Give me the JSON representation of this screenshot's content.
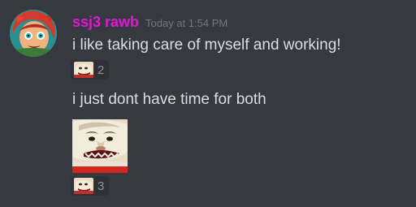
{
  "message": {
    "username": "ssj3 rawb",
    "username_color": "#e018d6",
    "timestamp": "Today at 1:54 PM",
    "lines": [
      "i like taking care of myself and working!",
      "i just dont have time for both"
    ]
  },
  "reactions": [
    {
      "emoji": "possum-face-emoji",
      "count": "2"
    },
    {
      "emoji": "possum-face-emoji",
      "count": "3"
    }
  ],
  "icons": {
    "avatar": "user-avatar",
    "big_emoji": "possum-face-emoji"
  }
}
